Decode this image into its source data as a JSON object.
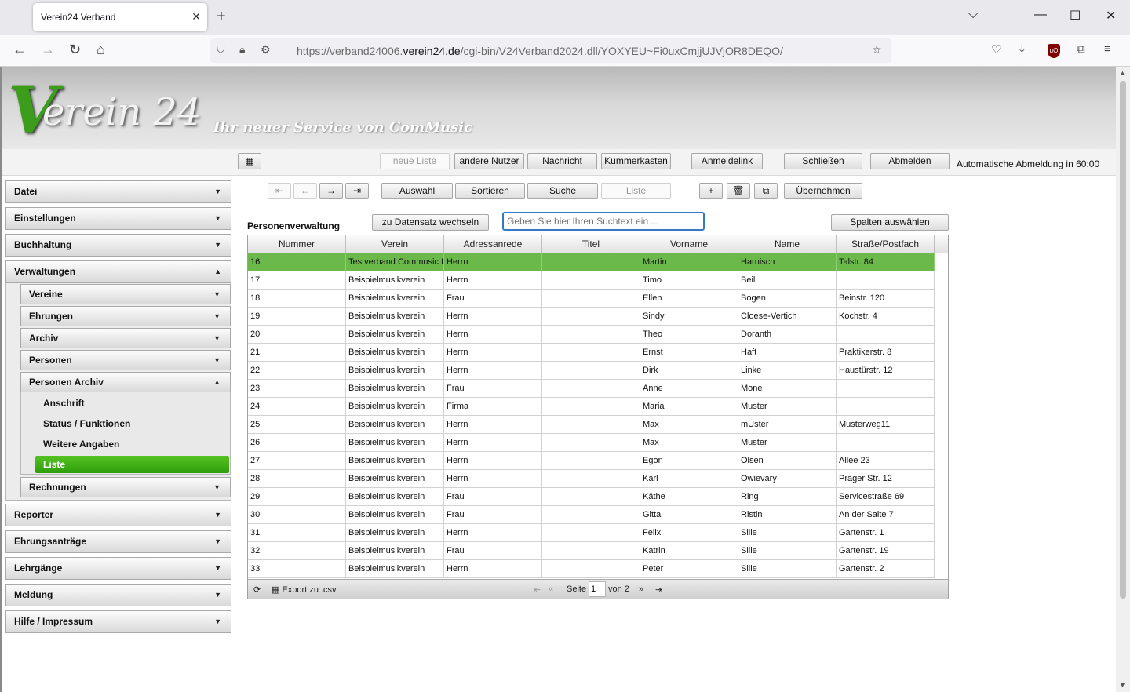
{
  "browser": {
    "tab_title": "Verein24 Verband",
    "url_prefix": "https://verband24006.",
    "url_domain": "verein24.de",
    "url_path": "/cgi-bin/V24Verband2024.dll/YOXYEU~Fi0uxCmjjUJVjOR8DEQO/"
  },
  "header": {
    "logo_v": "V",
    "logo_rest": "erein 24",
    "slogan": "Ihr neuer Service von ComMusic"
  },
  "toolbar": {
    "neue_liste": "neue Liste",
    "andere_nutzer": "andere Nutzer",
    "nachricht": "Nachricht",
    "kummerkasten": "Kummerkasten",
    "anmeldelink": "Anmeldelink",
    "schliessen": "Schließen",
    "abmelden": "Abmelden",
    "auto_logout": "Automatische Abmeldung in 60:00"
  },
  "sidebar": {
    "datei": "Datei",
    "einstellungen": "Einstellungen",
    "buchhaltung": "Buchhaltung",
    "verwaltungen": "Verwaltungen",
    "vereine": "Vereine",
    "ehrungen": "Ehrungen",
    "archiv": "Archiv",
    "personen": "Personen",
    "personen_archiv": "Personen Archiv",
    "anschrift": "Anschrift",
    "status_funktionen": "Status / Funktionen",
    "weitere_angaben": "Weitere Angaben",
    "liste": "Liste",
    "rechnungen": "Rechnungen",
    "reporter": "Reporter",
    "ehrungsantraege": "Ehrungsanträge",
    "lehrgaenge": "Lehrgänge",
    "meldung": "Meldung",
    "hilfe": "Hilfe / Impressum"
  },
  "content": {
    "auswahl": "Auswahl",
    "sortieren": "Sortieren",
    "suche": "Suche",
    "liste": "Liste",
    "uebernehmen": "Übernehmen",
    "section_title": "Personenverwaltung",
    "zu_datensatz": "zu Datensatz wechseln",
    "search_placeholder": "Geben Sie hier Ihren Suchtext ein ...",
    "spalten": "Spalten auswählen"
  },
  "grid": {
    "columns": [
      "Nummer",
      "Verein",
      "Adressanrede",
      "Titel",
      "Vorname",
      "Name",
      "Straße/Postfach"
    ],
    "rows": [
      [
        "16",
        "Testverband Commusic I",
        "Herrn",
        "",
        "Martin",
        "Harnisch",
        "Talstr. 84"
      ],
      [
        "17",
        "Beispielmusikverein",
        "Herrn",
        "",
        "Timo",
        "Beil",
        ""
      ],
      [
        "18",
        "Beispielmusikverein",
        "Frau",
        "",
        "Ellen",
        "Bogen",
        "Beinstr. 120"
      ],
      [
        "19",
        "Beispielmusikverein",
        "Herrn",
        "",
        "Sindy",
        "Cloese-Vertich",
        "Kochstr. 4"
      ],
      [
        "20",
        "Beispielmusikverein",
        "Herrn",
        "",
        "Theo",
        "Doranth",
        ""
      ],
      [
        "21",
        "Beispielmusikverein",
        "Herrn",
        "",
        "Ernst",
        "Haft",
        "Praktikerstr. 8"
      ],
      [
        "22",
        "Beispielmusikverein",
        "Herrn",
        "",
        "Dirk",
        "Linke",
        "Haustürstr. 12"
      ],
      [
        "23",
        "Beispielmusikverein",
        "Frau",
        "",
        "Anne",
        "Mone",
        ""
      ],
      [
        "24",
        "Beispielmusikverein",
        "Firma",
        "",
        "Maria",
        "Muster",
        ""
      ],
      [
        "25",
        "Beispielmusikverein",
        "Herrn",
        "",
        "Max",
        "mUster",
        "Musterweg11"
      ],
      [
        "26",
        "Beispielmusikverein",
        "Herrn",
        "",
        "Max",
        "Muster",
        ""
      ],
      [
        "27",
        "Beispielmusikverein",
        "Herrn",
        "",
        "Egon",
        "Olsen",
        "Allee 23"
      ],
      [
        "28",
        "Beispielmusikverein",
        "Herrn",
        "",
        "Karl",
        "Owievary",
        "Prager Str. 12"
      ],
      [
        "29",
        "Beispielmusikverein",
        "Frau",
        "",
        "Käthe",
        "Ring",
        "Servicestraße 69"
      ],
      [
        "30",
        "Beispielmusikverein",
        "Frau",
        "",
        "Gitta",
        "Ristin",
        "An der Saite 7"
      ],
      [
        "31",
        "Beispielmusikverein",
        "Herrn",
        "",
        "Felix",
        "Silie",
        "Gartenstr.   1"
      ],
      [
        "32",
        "Beispielmusikverein",
        "Frau",
        "",
        "Katrin",
        "Silie",
        "Gartenstr.  19"
      ],
      [
        "33",
        "Beispielmusikverein",
        "Herrn",
        "",
        "Peter",
        "Silie",
        "Gartenstr. 2"
      ]
    ],
    "export": "Export zu .csv",
    "seite": "Seite",
    "page": "1",
    "von": "von 2"
  },
  "colors": {
    "accent_green": "#3c9c1c",
    "selected_row": "#6ab94a"
  }
}
